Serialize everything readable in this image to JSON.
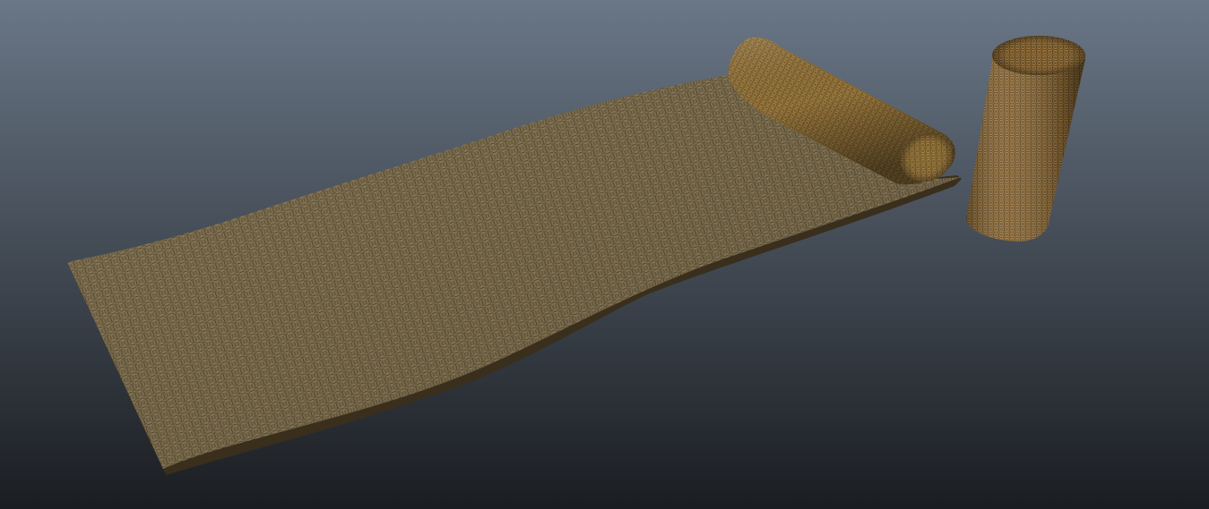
{
  "viewport": {
    "background_top": "#6a7787",
    "background_bottom": "#1a1d21"
  },
  "scene": {
    "objects": [
      {
        "kind": "woven-mat",
        "color_light": "#8a7a58",
        "color_dark": "#3e3320"
      },
      {
        "kind": "rolled-mat",
        "color_light": "#b08c4c",
        "color_dark": "#4a3514"
      },
      {
        "kind": "standing-roll",
        "color_light": "#a07c48",
        "color_dark": "#3c2a12"
      }
    ]
  }
}
